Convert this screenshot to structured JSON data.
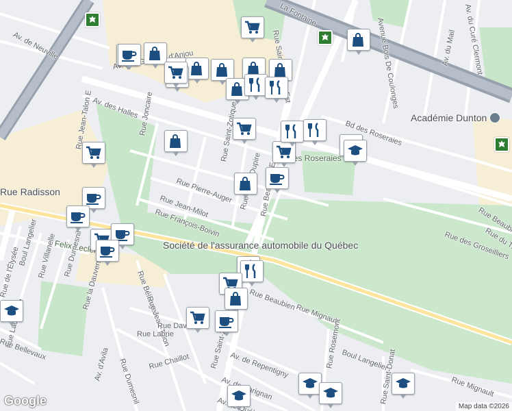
{
  "map": {
    "attribution": "Map data ©2026",
    "logo": "Google"
  },
  "colors": {
    "background": "#eceef2",
    "park": "#c8e6c9",
    "commercial": "#f7eed6",
    "highway": "#a8b0bc",
    "pin_icon": "#1c4e80"
  },
  "street_labels": [
    {
      "text": "La Fontaine"
    },
    {
      "text": "Avenue Bois De Coulonges"
    },
    {
      "text": "Av. du Curé Clermont"
    },
    {
      "text": "Av. de Neuville"
    },
    {
      "text": "Av. des Galeries d'Anjou"
    },
    {
      "text": "Av. du Mail"
    },
    {
      "text": "Rue Saint-Zotique Est"
    },
    {
      "text": "Av. des Halles"
    },
    {
      "text": "Bd des Roseraies"
    },
    {
      "text": "Académie Dunton"
    },
    {
      "text": "Rue Jean-Talon E"
    },
    {
      "text": "Rue Joncaire"
    },
    {
      "text": "Rue Saint-Zotique"
    },
    {
      "text": "Rue Beaubien E"
    },
    {
      "text": "Des Roseraies Park"
    },
    {
      "text": "Rue Pierre-Auger"
    },
    {
      "text": "Rue Jean-Milot"
    },
    {
      "text": "Rue Louis-Dupire"
    },
    {
      "text": "Rue François-Boivin"
    },
    {
      "text": "Rue Beaubien E"
    },
    {
      "text": "Rue du Trianon"
    },
    {
      "text": "Rue des Groseilliers"
    },
    {
      "text": "Rue Radisson"
    },
    {
      "text": "Société de l'assurance automobile du Québec"
    },
    {
      "text": "Felix-Leclerc Park"
    },
    {
      "text": "Boul Langelier"
    },
    {
      "text": "Rue Villanelle"
    },
    {
      "text": "Rue Dumesnil"
    },
    {
      "text": "Rue de l'Élysée"
    },
    {
      "text": "Rue Lachenaie"
    },
    {
      "text": "Rue la Dauversière"
    },
    {
      "text": "Rue Bélanger"
    },
    {
      "text": "Rue Jean-Talon"
    },
    {
      "text": "Rue Daveluy"
    },
    {
      "text": "Rue Labrie"
    },
    {
      "text": "Rue Dumesnil"
    },
    {
      "text": "Rue Chaillot"
    },
    {
      "text": "Rue Saint-Zotique Est"
    },
    {
      "text": "Rue Beaubien"
    },
    {
      "text": "Rue Mignault"
    },
    {
      "text": "Boul Langelier"
    },
    {
      "text": "Av. de Repentigny"
    },
    {
      "text": "Av. de Carignan"
    },
    {
      "text": "Av. de Québec"
    },
    {
      "text": "Av. d'Avila"
    },
    {
      "text": "Rue Bellevaux"
    },
    {
      "text": "Rue Rosemont"
    },
    {
      "text": "Rue Saint-Donat"
    },
    {
      "text": "Rue Mignault"
    }
  ],
  "pins": [
    {
      "name": "cafe-pin",
      "icon": "cafe"
    },
    {
      "name": "shopping-pin",
      "icon": "shopping"
    },
    {
      "name": "cafe-pin",
      "icon": "cafe"
    },
    {
      "name": "shopping-pin",
      "icon": "shopping"
    },
    {
      "name": "shopping-pin",
      "icon": "shopping"
    },
    {
      "name": "grocery-pin",
      "icon": "grocery"
    },
    {
      "name": "shopping-pin",
      "icon": "shopping"
    },
    {
      "name": "shopping-pin",
      "icon": "shopping"
    },
    {
      "name": "shopping-pin",
      "icon": "shopping"
    },
    {
      "name": "grocery-pin",
      "icon": "grocery"
    },
    {
      "name": "restaurant-pin",
      "icon": "restaurant"
    },
    {
      "name": "shopping-pin",
      "icon": "shopping"
    },
    {
      "name": "restaurant-pin",
      "icon": "restaurant"
    },
    {
      "name": "grocery-pin",
      "icon": "grocery"
    },
    {
      "name": "grocery-pin",
      "icon": "grocery"
    },
    {
      "name": "restaurant-pin",
      "icon": "restaurant"
    },
    {
      "name": "restaurant-pin",
      "icon": "restaurant"
    },
    {
      "name": "school-pin",
      "icon": "school"
    },
    {
      "name": "school-pin",
      "icon": "school"
    },
    {
      "name": "grocery-pin",
      "icon": "grocery"
    },
    {
      "name": "shopping-pin",
      "icon": "shopping"
    },
    {
      "name": "grocery-pin",
      "icon": "grocery"
    },
    {
      "name": "shopping-pin",
      "icon": "shopping"
    },
    {
      "name": "cafe-pin",
      "icon": "cafe"
    },
    {
      "name": "cafe-pin",
      "icon": "cafe"
    },
    {
      "name": "cafe-pin",
      "icon": "cafe"
    },
    {
      "name": "grocery-pin",
      "icon": "grocery"
    },
    {
      "name": "cafe-pin",
      "icon": "cafe"
    },
    {
      "name": "cafe-pin",
      "icon": "cafe"
    },
    {
      "name": "restaurant-pin",
      "icon": "restaurant"
    },
    {
      "name": "restaurant-pin",
      "icon": "restaurant"
    },
    {
      "name": "grocery-pin",
      "icon": "grocery"
    },
    {
      "name": "shopping-pin",
      "icon": "shopping"
    },
    {
      "name": "school-pin",
      "icon": "school"
    },
    {
      "name": "grocery-pin",
      "icon": "grocery"
    },
    {
      "name": "cafe-pin",
      "icon": "cafe"
    },
    {
      "name": "school-pin",
      "icon": "school"
    },
    {
      "name": "school-pin",
      "icon": "school"
    },
    {
      "name": "school-pin",
      "icon": "school"
    },
    {
      "name": "school-pin",
      "icon": "school"
    },
    {
      "name": "shopping-pin",
      "icon": "shopping"
    }
  ]
}
